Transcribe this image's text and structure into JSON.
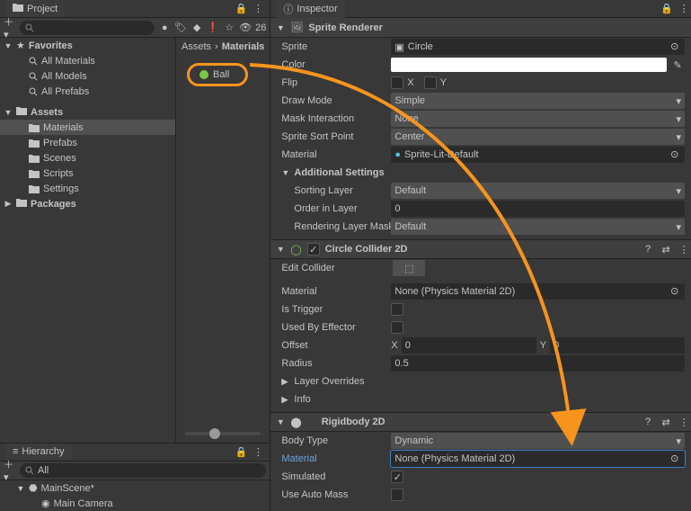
{
  "project": {
    "tab": "Project",
    "search_placeholder": "",
    "visible_count": "26",
    "favorites": {
      "label": "Favorites",
      "items": [
        "All Materials",
        "All Models",
        "All Prefabs"
      ]
    },
    "assets": {
      "label": "Assets",
      "items": [
        "Materials",
        "Prefabs",
        "Scenes",
        "Scripts",
        "Settings"
      ]
    },
    "packages": "Packages",
    "breadcrumb": [
      "Assets",
      "Materials"
    ],
    "asset_item": "Ball"
  },
  "hierarchy": {
    "tab": "Hierarchy",
    "search_placeholder": "All",
    "scene": "MainScene*",
    "children": [
      "Main Camera"
    ]
  },
  "inspector": {
    "tab": "Inspector",
    "sprite_renderer": {
      "title": "Sprite Renderer",
      "sprite_label": "Sprite",
      "sprite_value": "Circle",
      "color_label": "Color",
      "flip_label": "Flip",
      "flip_x": "X",
      "flip_y": "Y",
      "draw_mode_label": "Draw Mode",
      "draw_mode_value": "Simple",
      "mask_label": "Mask Interaction",
      "mask_value": "None",
      "sort_point_label": "Sprite Sort Point",
      "sort_point_value": "Center",
      "material_label": "Material",
      "material_value": "Sprite-Lit-Default",
      "additional": "Additional Settings",
      "sorting_layer_label": "Sorting Layer",
      "sorting_layer_value": "Default",
      "order_label": "Order in Layer",
      "order_value": "0",
      "render_mask_label": "Rendering Layer Mask",
      "render_mask_value": "Default"
    },
    "circle_collider": {
      "title": "Circle Collider 2D",
      "edit_label": "Edit Collider",
      "material_label": "Material",
      "material_value": "None (Physics Material 2D)",
      "trigger_label": "Is Trigger",
      "effector_label": "Used By Effector",
      "offset_label": "Offset",
      "offset_x_label": "X",
      "offset_x": "0",
      "offset_y_label": "Y",
      "offset_y": "0",
      "radius_label": "Radius",
      "radius_value": "0.5",
      "layer_overrides": "Layer Overrides",
      "info": "Info"
    },
    "rigidbody": {
      "title": "Rigidbody 2D",
      "body_type_label": "Body Type",
      "body_type_value": "Dynamic",
      "material_label": "Material",
      "material_value": "None (Physics Material 2D)",
      "simulated_label": "Simulated",
      "auto_mass_label": "Use Auto Mass"
    }
  }
}
